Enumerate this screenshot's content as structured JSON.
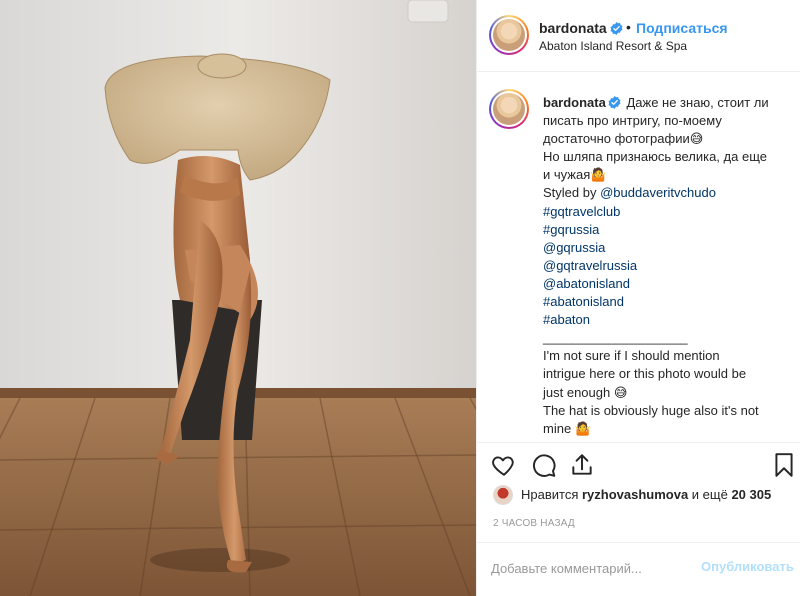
{
  "post": {
    "username": "bardonata",
    "follow_label": "Подписаться",
    "separator": "•",
    "location": "Abaton Island Resort & Spa"
  },
  "caption": {
    "username": "bardonata",
    "lines": [
      "Даже не знаю, стоит ли",
      "писать про интригу, по-моему",
      "достаточно фотографии😅",
      "Но шляпа признаюсь велика, да еще",
      "и чужая🤷",
      "Styled by ",
      "@buddaveritvchudo",
      "#gqtravelclub",
      "#gqrussia",
      "@gqrussia",
      "@gqtravelrussia",
      "@abatonisland",
      "#abatonisland",
      "#abaton",
      "____________________",
      "I'm not sure if I should mention",
      "intrigue here or this photo would be",
      "just enough 😅",
      "The hat is obviously huge also it's not",
      "mine 🤷"
    ]
  },
  "likes": {
    "prefix": "Нравится ",
    "user": "ryzhovashumova",
    "suffix": " и ещё ",
    "count": "20 305"
  },
  "timestamp": "2 часов назад",
  "comment": {
    "placeholder": "Добавьте комментарий...",
    "publish_label": "Опубликовать"
  },
  "colors": {
    "link": "#003569",
    "follow": "#3897f0",
    "verified": "#3897f0",
    "muted": "#999999",
    "publish_disabled": "#b2dffc"
  },
  "icons": [
    "heart-icon",
    "comment-icon",
    "share-icon",
    "bookmark-icon",
    "verified-badge-icon"
  ]
}
